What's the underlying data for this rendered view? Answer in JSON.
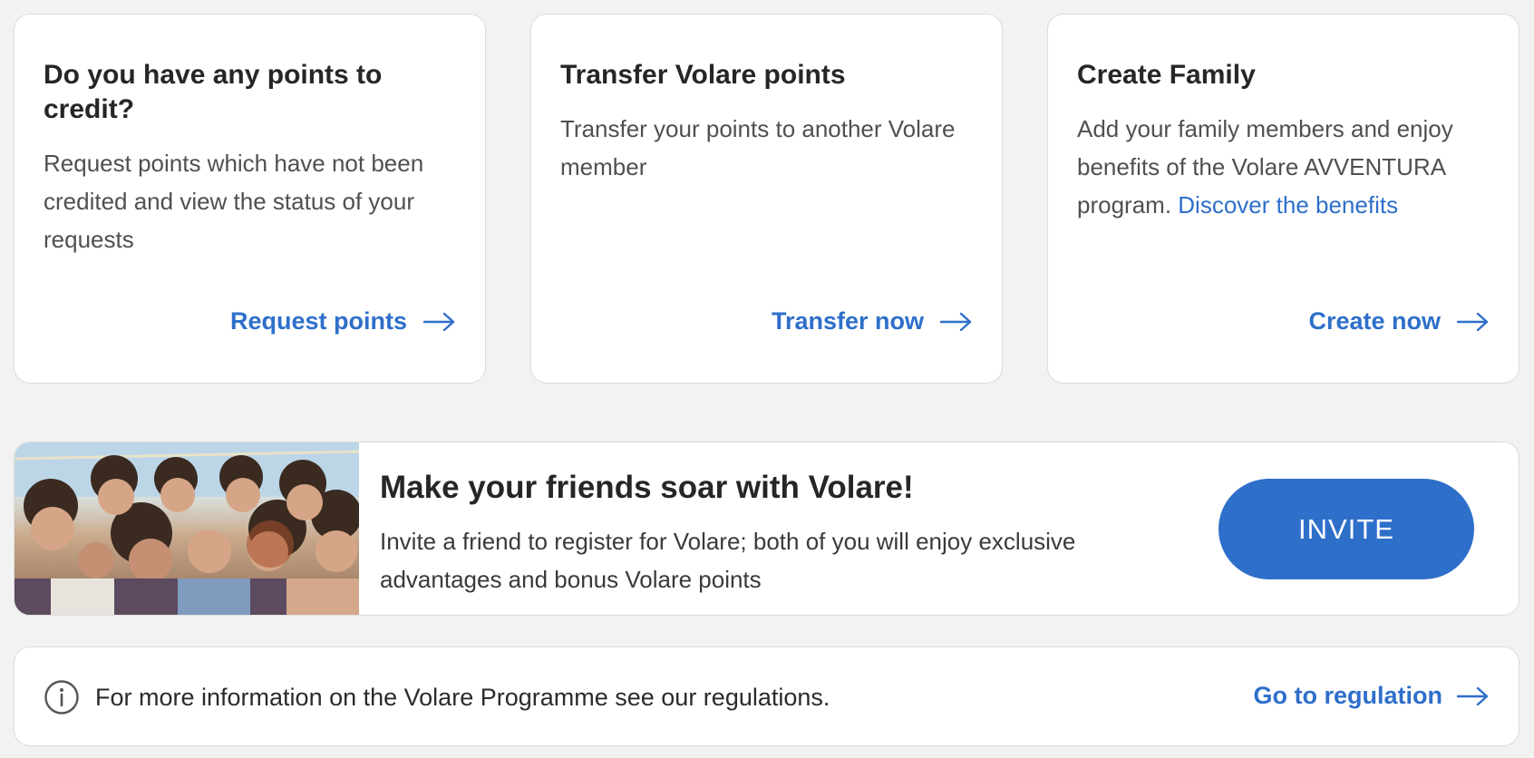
{
  "colors": {
    "accent": "#2e6fca",
    "background": "#f2f2f2",
    "card": "#ffffff",
    "text": "#262626"
  },
  "cards": [
    {
      "title": "Do you have any points to credit?",
      "description": "Request points which have not been credited and view the status of your requests",
      "action_label": "Request points",
      "action_icon": "arrow-right-icon"
    },
    {
      "title": "Transfer Volare points",
      "description": "Transfer your points to another Volare member",
      "action_label": "Transfer now",
      "action_icon": "arrow-right-icon"
    },
    {
      "title": "Create Family",
      "description": "Add your family members and enjoy benefits of the Volare AVVENTURA program.",
      "inline_link": "Discover the benefits",
      "action_label": "Create now",
      "action_icon": "arrow-right-icon"
    }
  ],
  "invite_banner": {
    "image": "group-of-friends-photo",
    "title": "Make your friends soar with Volare!",
    "description": "Invite a friend to register for Volare; both of you will enjoy exclusive advantages and bonus Volare points",
    "button_label": "INVITE"
  },
  "info_bar": {
    "icon": "info-icon",
    "text": "For more information on the Volare Programme see our regulations.",
    "action_label": "Go to regulation",
    "action_icon": "arrow-right-icon"
  }
}
